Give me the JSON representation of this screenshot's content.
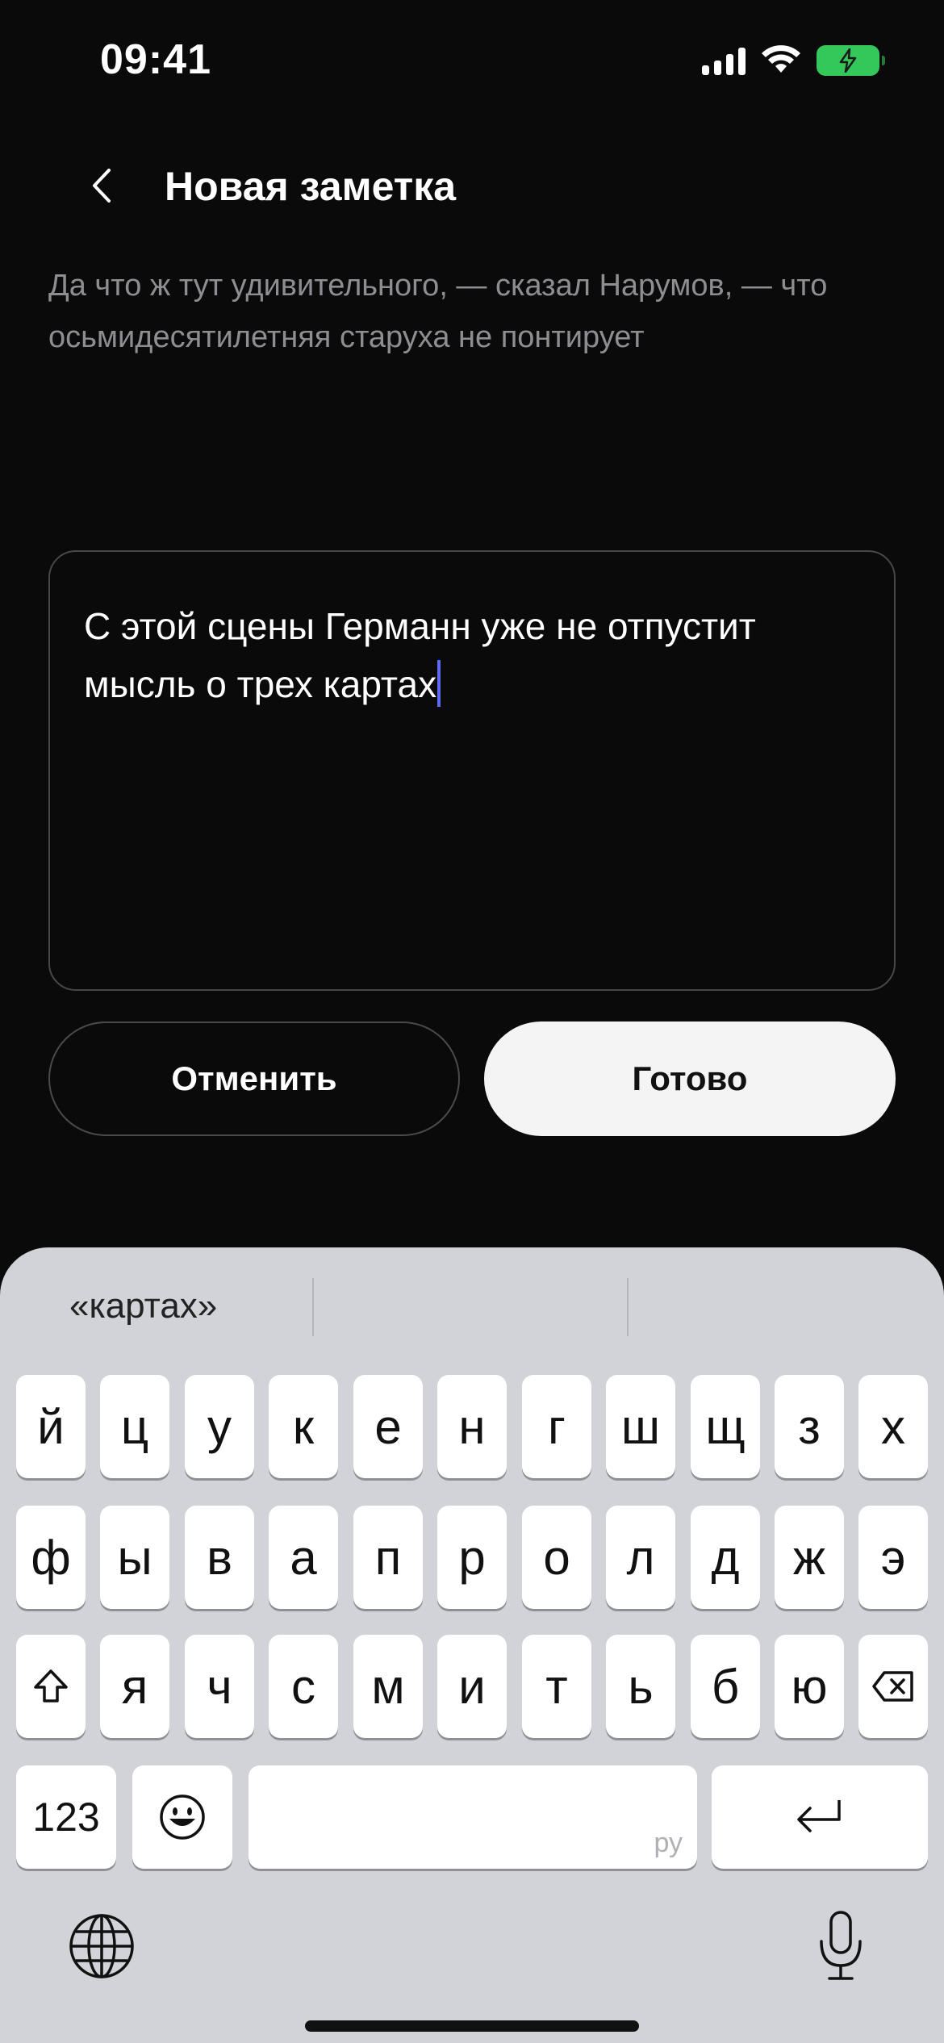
{
  "status_bar": {
    "time": "09:41",
    "icons": [
      "cellular-signal-icon",
      "wifi-icon",
      "battery-charging-icon"
    ],
    "battery_color": "#34c759"
  },
  "header": {
    "back_icon": "chevron-left-icon",
    "title": "Новая заметка"
  },
  "description": "Да что ж тут удивительного, — сказал Нарумов, — что осьмидесятилетняя старуха не понтирует",
  "note": {
    "value": "С этой сцены Германн уже не отпустит мысль о трех картах",
    "caret_color": "#5b6cf0"
  },
  "actions": {
    "cancel_label": "Отменить",
    "done_label": "Готово"
  },
  "keyboard": {
    "suggestions": [
      "«картах»",
      "",
      ""
    ],
    "rows": [
      [
        "й",
        "ц",
        "у",
        "к",
        "е",
        "н",
        "г",
        "ш",
        "щ",
        "з",
        "х"
      ],
      [
        "ф",
        "ы",
        "в",
        "а",
        "п",
        "р",
        "о",
        "л",
        "д",
        "ж",
        "э"
      ],
      [
        "я",
        "ч",
        "с",
        "м",
        "и",
        "т",
        "ь",
        "б",
        "ю"
      ]
    ],
    "numbers_label": "123",
    "space_lang": "ру",
    "icons": [
      "shift-icon",
      "backspace-icon",
      "emoji-icon",
      "return-icon",
      "globe-icon",
      "microphone-icon"
    ]
  }
}
